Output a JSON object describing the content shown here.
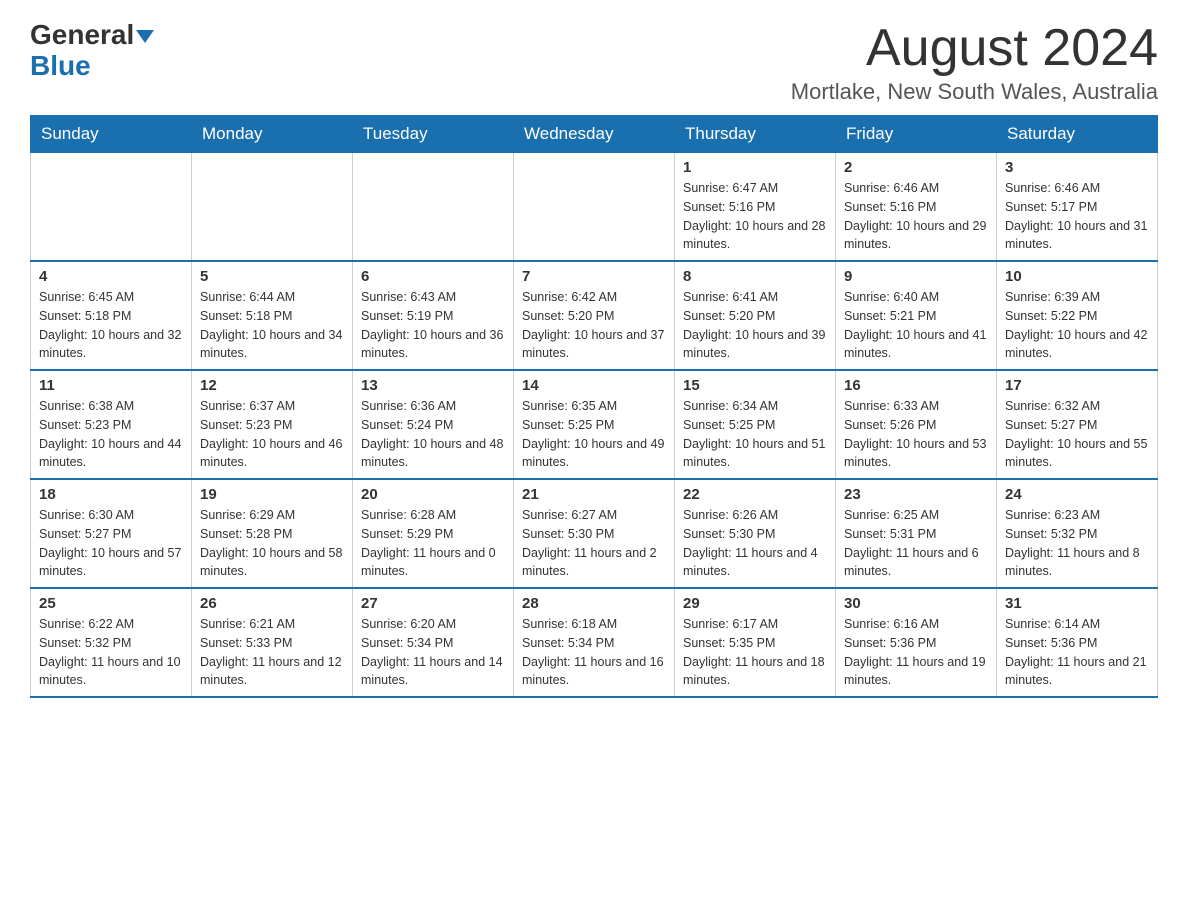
{
  "header": {
    "logo_general": "General",
    "logo_blue": "Blue",
    "month_year": "August 2024",
    "location": "Mortlake, New South Wales, Australia"
  },
  "days_of_week": [
    "Sunday",
    "Monday",
    "Tuesday",
    "Wednesday",
    "Thursday",
    "Friday",
    "Saturday"
  ],
  "weeks": [
    [
      {
        "day": "",
        "info": ""
      },
      {
        "day": "",
        "info": ""
      },
      {
        "day": "",
        "info": ""
      },
      {
        "day": "",
        "info": ""
      },
      {
        "day": "1",
        "info": "Sunrise: 6:47 AM\nSunset: 5:16 PM\nDaylight: 10 hours and 28 minutes."
      },
      {
        "day": "2",
        "info": "Sunrise: 6:46 AM\nSunset: 5:16 PM\nDaylight: 10 hours and 29 minutes."
      },
      {
        "day": "3",
        "info": "Sunrise: 6:46 AM\nSunset: 5:17 PM\nDaylight: 10 hours and 31 minutes."
      }
    ],
    [
      {
        "day": "4",
        "info": "Sunrise: 6:45 AM\nSunset: 5:18 PM\nDaylight: 10 hours and 32 minutes."
      },
      {
        "day": "5",
        "info": "Sunrise: 6:44 AM\nSunset: 5:18 PM\nDaylight: 10 hours and 34 minutes."
      },
      {
        "day": "6",
        "info": "Sunrise: 6:43 AM\nSunset: 5:19 PM\nDaylight: 10 hours and 36 minutes."
      },
      {
        "day": "7",
        "info": "Sunrise: 6:42 AM\nSunset: 5:20 PM\nDaylight: 10 hours and 37 minutes."
      },
      {
        "day": "8",
        "info": "Sunrise: 6:41 AM\nSunset: 5:20 PM\nDaylight: 10 hours and 39 minutes."
      },
      {
        "day": "9",
        "info": "Sunrise: 6:40 AM\nSunset: 5:21 PM\nDaylight: 10 hours and 41 minutes."
      },
      {
        "day": "10",
        "info": "Sunrise: 6:39 AM\nSunset: 5:22 PM\nDaylight: 10 hours and 42 minutes."
      }
    ],
    [
      {
        "day": "11",
        "info": "Sunrise: 6:38 AM\nSunset: 5:23 PM\nDaylight: 10 hours and 44 minutes."
      },
      {
        "day": "12",
        "info": "Sunrise: 6:37 AM\nSunset: 5:23 PM\nDaylight: 10 hours and 46 minutes."
      },
      {
        "day": "13",
        "info": "Sunrise: 6:36 AM\nSunset: 5:24 PM\nDaylight: 10 hours and 48 minutes."
      },
      {
        "day": "14",
        "info": "Sunrise: 6:35 AM\nSunset: 5:25 PM\nDaylight: 10 hours and 49 minutes."
      },
      {
        "day": "15",
        "info": "Sunrise: 6:34 AM\nSunset: 5:25 PM\nDaylight: 10 hours and 51 minutes."
      },
      {
        "day": "16",
        "info": "Sunrise: 6:33 AM\nSunset: 5:26 PM\nDaylight: 10 hours and 53 minutes."
      },
      {
        "day": "17",
        "info": "Sunrise: 6:32 AM\nSunset: 5:27 PM\nDaylight: 10 hours and 55 minutes."
      }
    ],
    [
      {
        "day": "18",
        "info": "Sunrise: 6:30 AM\nSunset: 5:27 PM\nDaylight: 10 hours and 57 minutes."
      },
      {
        "day": "19",
        "info": "Sunrise: 6:29 AM\nSunset: 5:28 PM\nDaylight: 10 hours and 58 minutes."
      },
      {
        "day": "20",
        "info": "Sunrise: 6:28 AM\nSunset: 5:29 PM\nDaylight: 11 hours and 0 minutes."
      },
      {
        "day": "21",
        "info": "Sunrise: 6:27 AM\nSunset: 5:30 PM\nDaylight: 11 hours and 2 minutes."
      },
      {
        "day": "22",
        "info": "Sunrise: 6:26 AM\nSunset: 5:30 PM\nDaylight: 11 hours and 4 minutes."
      },
      {
        "day": "23",
        "info": "Sunrise: 6:25 AM\nSunset: 5:31 PM\nDaylight: 11 hours and 6 minutes."
      },
      {
        "day": "24",
        "info": "Sunrise: 6:23 AM\nSunset: 5:32 PM\nDaylight: 11 hours and 8 minutes."
      }
    ],
    [
      {
        "day": "25",
        "info": "Sunrise: 6:22 AM\nSunset: 5:32 PM\nDaylight: 11 hours and 10 minutes."
      },
      {
        "day": "26",
        "info": "Sunrise: 6:21 AM\nSunset: 5:33 PM\nDaylight: 11 hours and 12 minutes."
      },
      {
        "day": "27",
        "info": "Sunrise: 6:20 AM\nSunset: 5:34 PM\nDaylight: 11 hours and 14 minutes."
      },
      {
        "day": "28",
        "info": "Sunrise: 6:18 AM\nSunset: 5:34 PM\nDaylight: 11 hours and 16 minutes."
      },
      {
        "day": "29",
        "info": "Sunrise: 6:17 AM\nSunset: 5:35 PM\nDaylight: 11 hours and 18 minutes."
      },
      {
        "day": "30",
        "info": "Sunrise: 6:16 AM\nSunset: 5:36 PM\nDaylight: 11 hours and 19 minutes."
      },
      {
        "day": "31",
        "info": "Sunrise: 6:14 AM\nSunset: 5:36 PM\nDaylight: 11 hours and 21 minutes."
      }
    ]
  ]
}
